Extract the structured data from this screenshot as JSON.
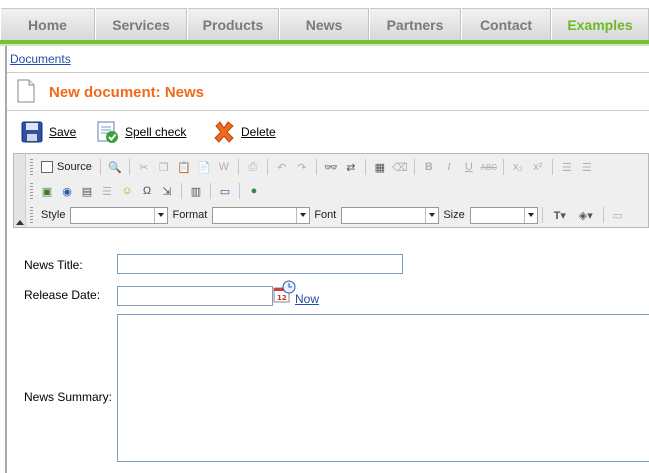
{
  "nav": {
    "tabs": [
      {
        "label": "Home",
        "active": false
      },
      {
        "label": "Services",
        "active": false
      },
      {
        "label": "Products",
        "active": false
      },
      {
        "label": "News",
        "active": false
      },
      {
        "label": "Partners",
        "active": false
      },
      {
        "label": "Contact",
        "active": false
      },
      {
        "label": "Examples",
        "active": true
      }
    ],
    "active_color": "#6cb82a"
  },
  "breadcrumb": "Documents",
  "page": {
    "title": "New document: News",
    "title_color": "#f06a1c"
  },
  "actions": {
    "save": "Save",
    "spell_check": "Spell check",
    "delete": "Delete"
  },
  "editor": {
    "source_label": "Source",
    "style_label": "Style",
    "format_label": "Format",
    "font_label": "Font",
    "size_label": "Size",
    "style_value": "",
    "format_value": "",
    "font_value": "",
    "size_value": ""
  },
  "form": {
    "news_title_label": "News Title:",
    "news_title_value": "",
    "release_date_label": "Release Date:",
    "release_date_value": "",
    "now_link": "Now",
    "news_summary_label": "News Summary:",
    "news_summary_value": ""
  }
}
